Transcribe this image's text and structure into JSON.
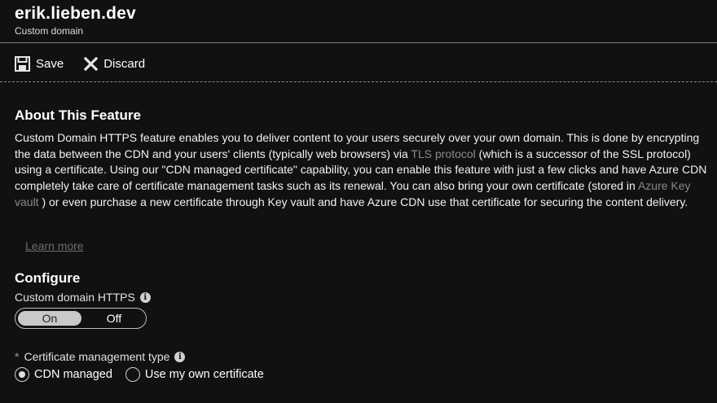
{
  "header": {
    "title": "erik.lieben.dev",
    "subtitle": "Custom domain"
  },
  "toolbar": {
    "save_label": "Save",
    "discard_label": "Discard"
  },
  "about": {
    "title": "About This Feature",
    "text_part1": "Custom Domain HTTPS feature enables you to deliver content to your users securely over your own domain. This is done by encrypting the data between the CDN and your users' clients (typically web browsers) via ",
    "link_tls": "TLS protocol",
    "text_part2": " (which is a successor of the SSL protocol) using a certificate. Using our \"CDN managed certificate\" capability, you can enable this feature with just a few clicks and have Azure CDN completely take care of certificate management tasks such as its renewal. You can also bring your own certificate (stored in ",
    "link_keyvault": "Azure Key vault",
    "text_part3": " ) or even purchase a new certificate through Key vault and have Azure CDN use that certificate for securing the content delivery.",
    "learn_more": "Learn more"
  },
  "configure": {
    "title": "Configure",
    "https_label": "Custom domain HTTPS",
    "toggle": {
      "on_label": "On",
      "off_label": "Off",
      "selected": "On"
    },
    "cert_required_marker": "*",
    "cert_label": "Certificate management type",
    "options": {
      "cdn_managed": "CDN managed",
      "own_cert": "Use my own certificate"
    },
    "selected_option": "CDN managed"
  },
  "icons": {
    "save": "save-icon",
    "discard": "close-icon",
    "info": "info-icon"
  },
  "colors": {
    "background": "#111111",
    "link": "#8a8a8a",
    "toggle_selected": "#c9c9c9"
  }
}
